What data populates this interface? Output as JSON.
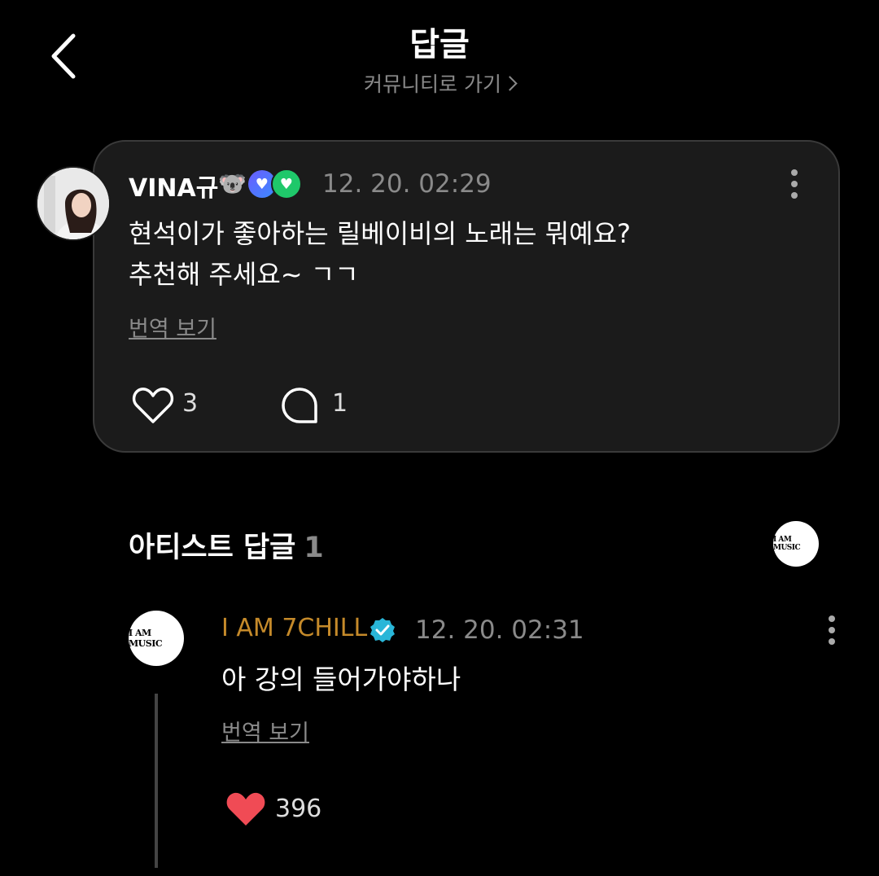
{
  "header": {
    "title": "답글",
    "community_link": "커뮤니티로 가기"
  },
  "post": {
    "username": "VINA규",
    "emoji": "🐨",
    "time": "12. 20. 02:29",
    "text_line1": "현석이가 좋아하는 릴베이비의 노래는 뭐예요?",
    "text_line2": "추천해 주세요~ ㄱㄱ",
    "translate_label": "번역 보기",
    "like_count": "3",
    "reply_count": "1"
  },
  "artist_section": {
    "title": "아티스트 답글",
    "count": "1",
    "avatar_text": "I AM MUSIC"
  },
  "reply": {
    "avatar_text": "I AM MUSIC",
    "username": "I AM 7CHILL",
    "time": "12. 20. 02:31",
    "text": "아 강의 들어가야하나",
    "translate_label": "번역 보기",
    "like_count": "396"
  },
  "colors": {
    "background": "#000000",
    "card": "#1b1b1b",
    "artist_name": "#c58a2a",
    "heart": "#f04b55",
    "verified": "#29b6d8"
  }
}
